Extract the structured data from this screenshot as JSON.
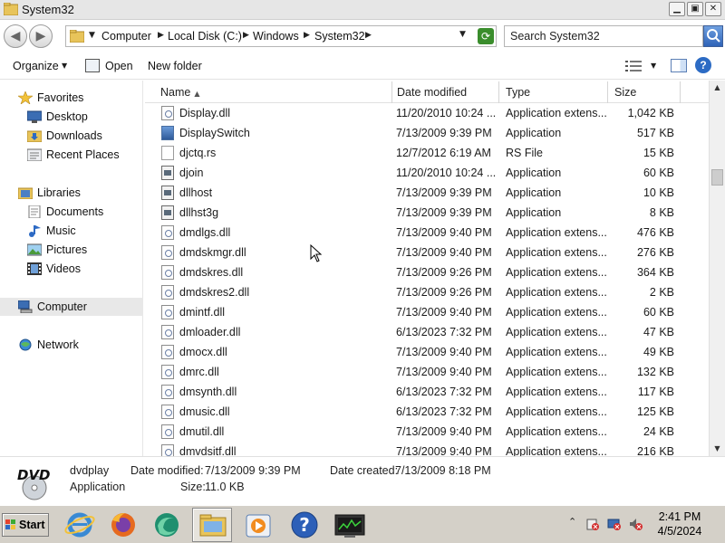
{
  "window": {
    "title": "System32",
    "controls": {
      "minimize": "▁",
      "maximize": "▣",
      "close": "✕"
    }
  },
  "address": {
    "crumbs": [
      "Computer",
      "Local Disk (C:)",
      "Windows",
      "System32"
    ],
    "search_placeholder": "Search System32"
  },
  "toolbar": {
    "organize": "Organize",
    "open": "Open",
    "new_folder": "New folder"
  },
  "nav": {
    "favorites": {
      "label": "Favorites",
      "items": [
        "Desktop",
        "Downloads",
        "Recent Places"
      ]
    },
    "libraries": {
      "label": "Libraries",
      "items": [
        "Documents",
        "Music",
        "Pictures",
        "Videos"
      ]
    },
    "computer": "Computer",
    "network": "Network"
  },
  "columns": {
    "name": "Name",
    "date": "Date modified",
    "type": "Type",
    "size": "Size"
  },
  "files": [
    {
      "name": "Display.dll",
      "date": "11/20/2010 10:24 ...",
      "type": "Application extens...",
      "size": "1,042 KB",
      "icon": "dll"
    },
    {
      "name": "DisplaySwitch",
      "date": "7/13/2009 9:39 PM",
      "type": "Application",
      "size": "517 KB",
      "icon": "display"
    },
    {
      "name": "djctq.rs",
      "date": "12/7/2012 6:19 AM",
      "type": "RS File",
      "size": "15 KB",
      "icon": "file"
    },
    {
      "name": "djoin",
      "date": "11/20/2010 10:24 ...",
      "type": "Application",
      "size": "60 KB",
      "icon": "exe"
    },
    {
      "name": "dllhost",
      "date": "7/13/2009 9:39 PM",
      "type": "Application",
      "size": "10 KB",
      "icon": "exe"
    },
    {
      "name": "dllhst3g",
      "date": "7/13/2009 9:39 PM",
      "type": "Application",
      "size": "8 KB",
      "icon": "exe"
    },
    {
      "name": "dmdlgs.dll",
      "date": "7/13/2009 9:40 PM",
      "type": "Application extens...",
      "size": "476 KB",
      "icon": "dll"
    },
    {
      "name": "dmdskmgr.dll",
      "date": "7/13/2009 9:40 PM",
      "type": "Application extens...",
      "size": "276 KB",
      "icon": "dll"
    },
    {
      "name": "dmdskres.dll",
      "date": "7/13/2009 9:26 PM",
      "type": "Application extens...",
      "size": "364 KB",
      "icon": "dll"
    },
    {
      "name": "dmdskres2.dll",
      "date": "7/13/2009 9:26 PM",
      "type": "Application extens...",
      "size": "2 KB",
      "icon": "dll"
    },
    {
      "name": "dmintf.dll",
      "date": "7/13/2009 9:40 PM",
      "type": "Application extens...",
      "size": "60 KB",
      "icon": "dll"
    },
    {
      "name": "dmloader.dll",
      "date": "6/13/2023 7:32 PM",
      "type": "Application extens...",
      "size": "47 KB",
      "icon": "dll"
    },
    {
      "name": "dmocx.dll",
      "date": "7/13/2009 9:40 PM",
      "type": "Application extens...",
      "size": "49 KB",
      "icon": "dll"
    },
    {
      "name": "dmrc.dll",
      "date": "7/13/2009 9:40 PM",
      "type": "Application extens...",
      "size": "132 KB",
      "icon": "dll"
    },
    {
      "name": "dmsynth.dll",
      "date": "6/13/2023 7:32 PM",
      "type": "Application extens...",
      "size": "117 KB",
      "icon": "dll"
    },
    {
      "name": "dmusic.dll",
      "date": "6/13/2023 7:32 PM",
      "type": "Application extens...",
      "size": "125 KB",
      "icon": "dll"
    },
    {
      "name": "dmutil.dll",
      "date": "7/13/2009 9:40 PM",
      "type": "Application extens...",
      "size": "24 KB",
      "icon": "dll"
    },
    {
      "name": "dmvdsitf.dll",
      "date": "7/13/2009 9:40 PM",
      "type": "Application extens...",
      "size": "216 KB",
      "icon": "dll"
    }
  ],
  "details": {
    "name": "dvdplay",
    "type": "Application",
    "modified_label": "Date modified:",
    "modified_value": "7/13/2009 9:39 PM",
    "created_label": "Date created:",
    "created_value": "7/13/2009 8:18 PM",
    "size_label": "Size:",
    "size_value": "11.0 KB",
    "icon_text": "DVD"
  },
  "taskbar": {
    "start": "Start",
    "time": "2:41 PM",
    "date": "4/5/2024",
    "tray_expand": "⌃"
  }
}
